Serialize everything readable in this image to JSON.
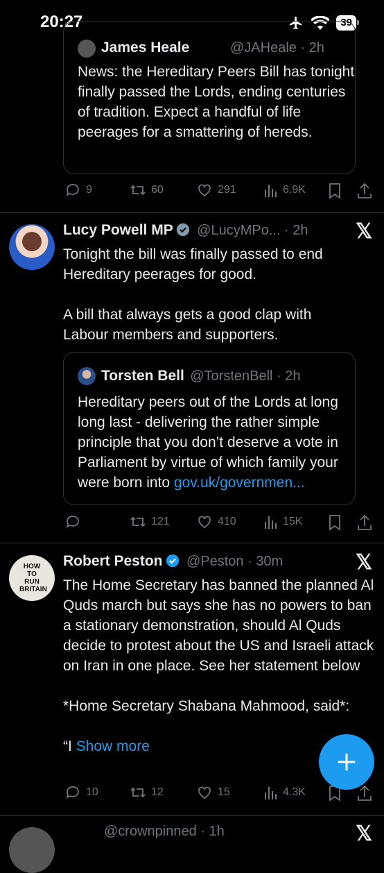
{
  "status": {
    "time": "20:27",
    "battery": "39"
  },
  "tweet0": {
    "quote_name": "James Heale",
    "quote_handle": "@JAHeale · 2h",
    "quote_text": "News: the Hereditary Peers Bill has tonight finally passed the Lords, ending centuries of tradition. Expect a handful of life peerages for a smattering of hereds.",
    "replies": "9",
    "reposts": "60",
    "likes": "291",
    "views": "6.9K"
  },
  "tweet1": {
    "name": "Lucy Powell MP",
    "handle": "@LucyMPo... · 2h",
    "text": "Tonight the bill was finally passed to end Hereditary peerages for good.\n\nA bill that always gets a good clap with Labour members and supporters.",
    "quote_name": "Torsten Bell",
    "quote_handle": "@TorstenBell · 2h",
    "quote_text": "Hereditary peers out of the Lords at long long last - delivering the rather simple principle that you don’t deserve a vote in Parliament by virtue of which family your were born into ",
    "quote_link": "gov.uk/governmen...",
    "replies": "",
    "reposts": "121",
    "likes": "410",
    "views": "15K"
  },
  "tweet2": {
    "name": "Robert Peston",
    "handle": "@Peston · 30m",
    "avatar_text": "HOW TO RUN BRITAIN",
    "text": "The Home Secretary has banned the planned Al Quds march but says she has no powers to ban a stationary demonstration, should Al Quds decide to protest about the US and Israeli attack on Iran in one place. See her statement below\n\n*Home Secretary Shabana Mahmood, said*:\n\n“I ",
    "show_more": "Show more",
    "replies": "10",
    "reposts": "12",
    "likes": "15",
    "views": "4.3K"
  },
  "tweet3": {
    "handle": "@crownpinned · 1h"
  },
  "colors": {
    "accent": "#1d9bf0",
    "background": "#000000",
    "secondary_text": "#71767b"
  }
}
